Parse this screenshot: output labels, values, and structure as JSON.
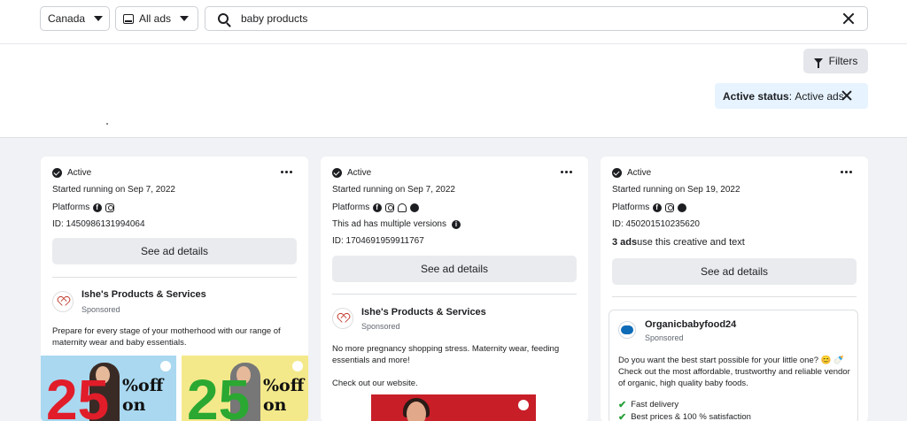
{
  "search_bar": {
    "country": "Canada",
    "ad_type": "All ads",
    "query": "baby products"
  },
  "filters": {
    "button_label": "Filters",
    "active_status_key": "Active status",
    "active_status_value": "Active ads"
  },
  "cards": [
    {
      "status": "Active",
      "started": "Started running on Sep 7, 2022",
      "platforms_label": "Platforms",
      "platform_icons": [
        "facebook-icon",
        "instagram-icon"
      ],
      "id": "ID: 1450986131994064",
      "see_details": "See ad details",
      "advertiser": "Ishe's Products & Services",
      "sponsored": "Sponsored",
      "body": "Prepare for every stage of your motherhood with our range of maternity wear and baby essentials.",
      "promo_big": "25",
      "promo_off": "%off on",
      "promo_colors": [
        "#e11d2a",
        "#2aa832"
      ],
      "promo_backgrounds": [
        "#a9d8f0",
        "#f4e98a"
      ]
    },
    {
      "status": "Active",
      "started": "Started running on Sep 7, 2022",
      "platforms_label": "Platforms",
      "platform_icons": [
        "facebook-icon",
        "instagram-icon",
        "audience-network-icon",
        "messenger-icon"
      ],
      "versions": "This ad has multiple versions",
      "id": "ID: 1704691959911767",
      "see_details": "See ad details",
      "advertiser": "Ishe's Products & Services",
      "sponsored": "Sponsored",
      "body": "No more pregnancy shopping stress. Maternity wear, feeding essentials and more!",
      "body2": "Check out our website."
    },
    {
      "status": "Active",
      "started": "Started running on Sep 19, 2022",
      "platforms_label": "Platforms",
      "platform_icons": [
        "facebook-icon",
        "instagram-icon",
        "messenger-icon"
      ],
      "id": "ID: 450201510235620",
      "creative_count": "3 ads",
      "creative_text": " use this creative and text",
      "see_details": "See ad details",
      "advertiser": "Organicbabyfood24",
      "sponsored": "Sponsored",
      "body": "Do you want the best start possible for your little one? 😊 🍼 Check out the most affordable, trustworthy and reliable vendor of organic, high quality baby foods.",
      "bullets": [
        "Fast delivery",
        "Best prices & 100 % satisfaction"
      ]
    }
  ]
}
